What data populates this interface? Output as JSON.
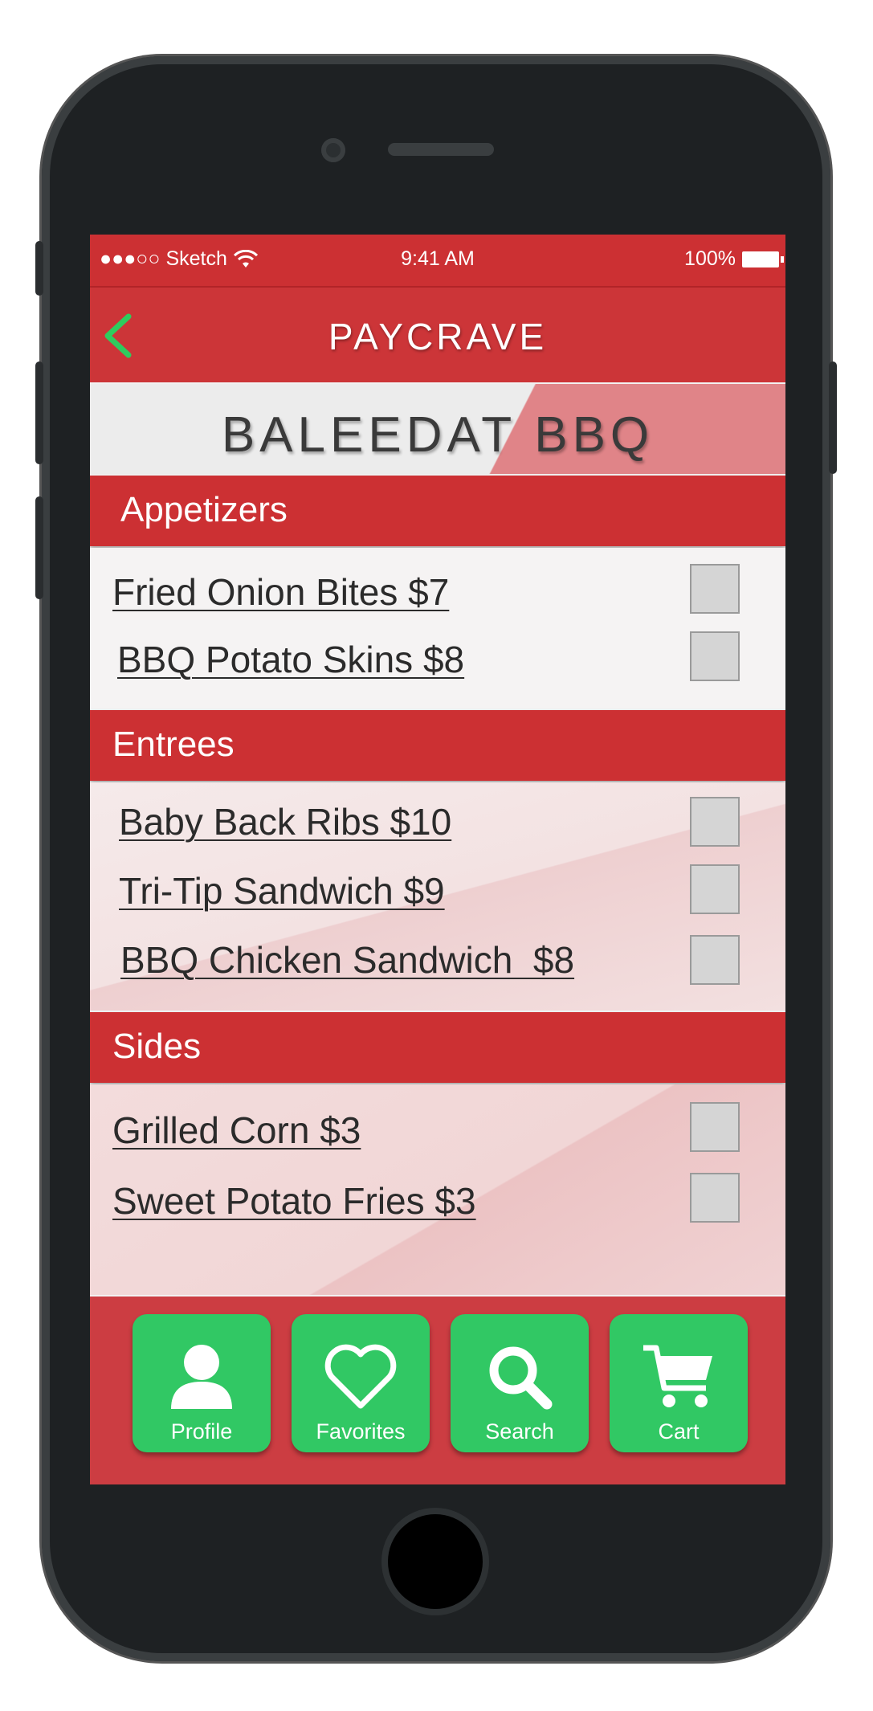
{
  "status_bar": {
    "carrier": "●●●○○ Sketch",
    "time": "9:41 AM",
    "battery": "100%"
  },
  "nav": {
    "title": "PAYCRAVE",
    "back_icon": "chevron-left-icon"
  },
  "restaurant": {
    "name": "BALEEDAT BBQ"
  },
  "sections": [
    {
      "title": "Appetizers",
      "items": [
        {
          "label": "Fried Onion Bites $7",
          "checked": false
        },
        {
          "label": "BBQ Potato Skins $8",
          "checked": false
        }
      ]
    },
    {
      "title": "Entrees",
      "items": [
        {
          "label": "Baby Back Ribs $10",
          "checked": false
        },
        {
          "label": "Tri-Tip Sandwich $9",
          "checked": false
        },
        {
          "label": "BBQ Chicken Sandwich  $8",
          "checked": false
        }
      ]
    },
    {
      "title": "Sides",
      "items": [
        {
          "label": "Grilled Corn $3",
          "checked": false
        },
        {
          "label": "Sweet Potato Fries $3",
          "checked": false
        }
      ]
    }
  ],
  "tabs": [
    {
      "label": "Profile",
      "icon": "person-icon"
    },
    {
      "label": "Favorites",
      "icon": "heart-icon"
    },
    {
      "label": "Search",
      "icon": "search-icon"
    },
    {
      "label": "Cart",
      "icon": "cart-icon"
    }
  ],
  "colors": {
    "header_red": "#cc3033",
    "tab_green": "#31c864",
    "accent_pink": "#e08488"
  }
}
